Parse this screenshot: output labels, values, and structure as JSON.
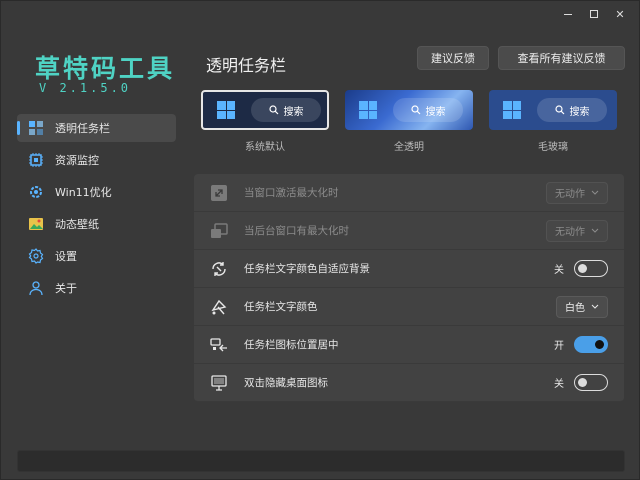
{
  "window": {
    "minimize": "—",
    "maximize": "□",
    "close": "✕"
  },
  "app": {
    "title": "草特码工具",
    "version": "V 2.1.5.0"
  },
  "sidebar": {
    "items": [
      {
        "label": "透明任务栏",
        "icon": "taskbar-icon",
        "active": true
      },
      {
        "label": "资源监控",
        "icon": "chip-icon"
      },
      {
        "label": "Win11优化",
        "icon": "gear-optimize-icon"
      },
      {
        "label": "动态壁纸",
        "icon": "wallpaper-icon"
      },
      {
        "label": "设置",
        "icon": "settings-icon"
      },
      {
        "label": "关于",
        "icon": "user-icon"
      }
    ]
  },
  "header": {
    "title": "透明任务栏",
    "feedback_label": "建议反馈",
    "view_feedback_label": "查看所有建议反馈"
  },
  "previews": [
    {
      "label": "系统默认",
      "search": "搜索",
      "selected": true
    },
    {
      "label": "全透明",
      "search": "搜索"
    },
    {
      "label": "毛玻璃",
      "search": "搜索"
    }
  ],
  "settings": [
    {
      "label": "当窗口激活最大化时",
      "icon": "maximize-window-icon",
      "control": "dropdown",
      "value": "无动作",
      "disabled": true
    },
    {
      "label": "当后台窗口有最大化时",
      "icon": "background-window-icon",
      "control": "dropdown",
      "value": "无动作",
      "disabled": true
    },
    {
      "label": "任务栏文字颜色自适应背景",
      "icon": "adaptive-color-icon",
      "control": "toggle",
      "state_label": "关",
      "on": false
    },
    {
      "label": "任务栏文字颜色",
      "icon": "paint-icon",
      "control": "dropdown",
      "value": "白色"
    },
    {
      "label": "任务栏图标位置居中",
      "icon": "center-icons-icon",
      "control": "toggle",
      "state_label": "开",
      "on": true
    },
    {
      "label": "双击隐藏桌面图标",
      "icon": "desktop-icon",
      "control": "toggle",
      "state_label": "关",
      "on": false
    }
  ],
  "colors": {
    "accent": "#5ab4ff",
    "title": "#4fd3c4",
    "toggle_on": "#4a9fe8"
  }
}
